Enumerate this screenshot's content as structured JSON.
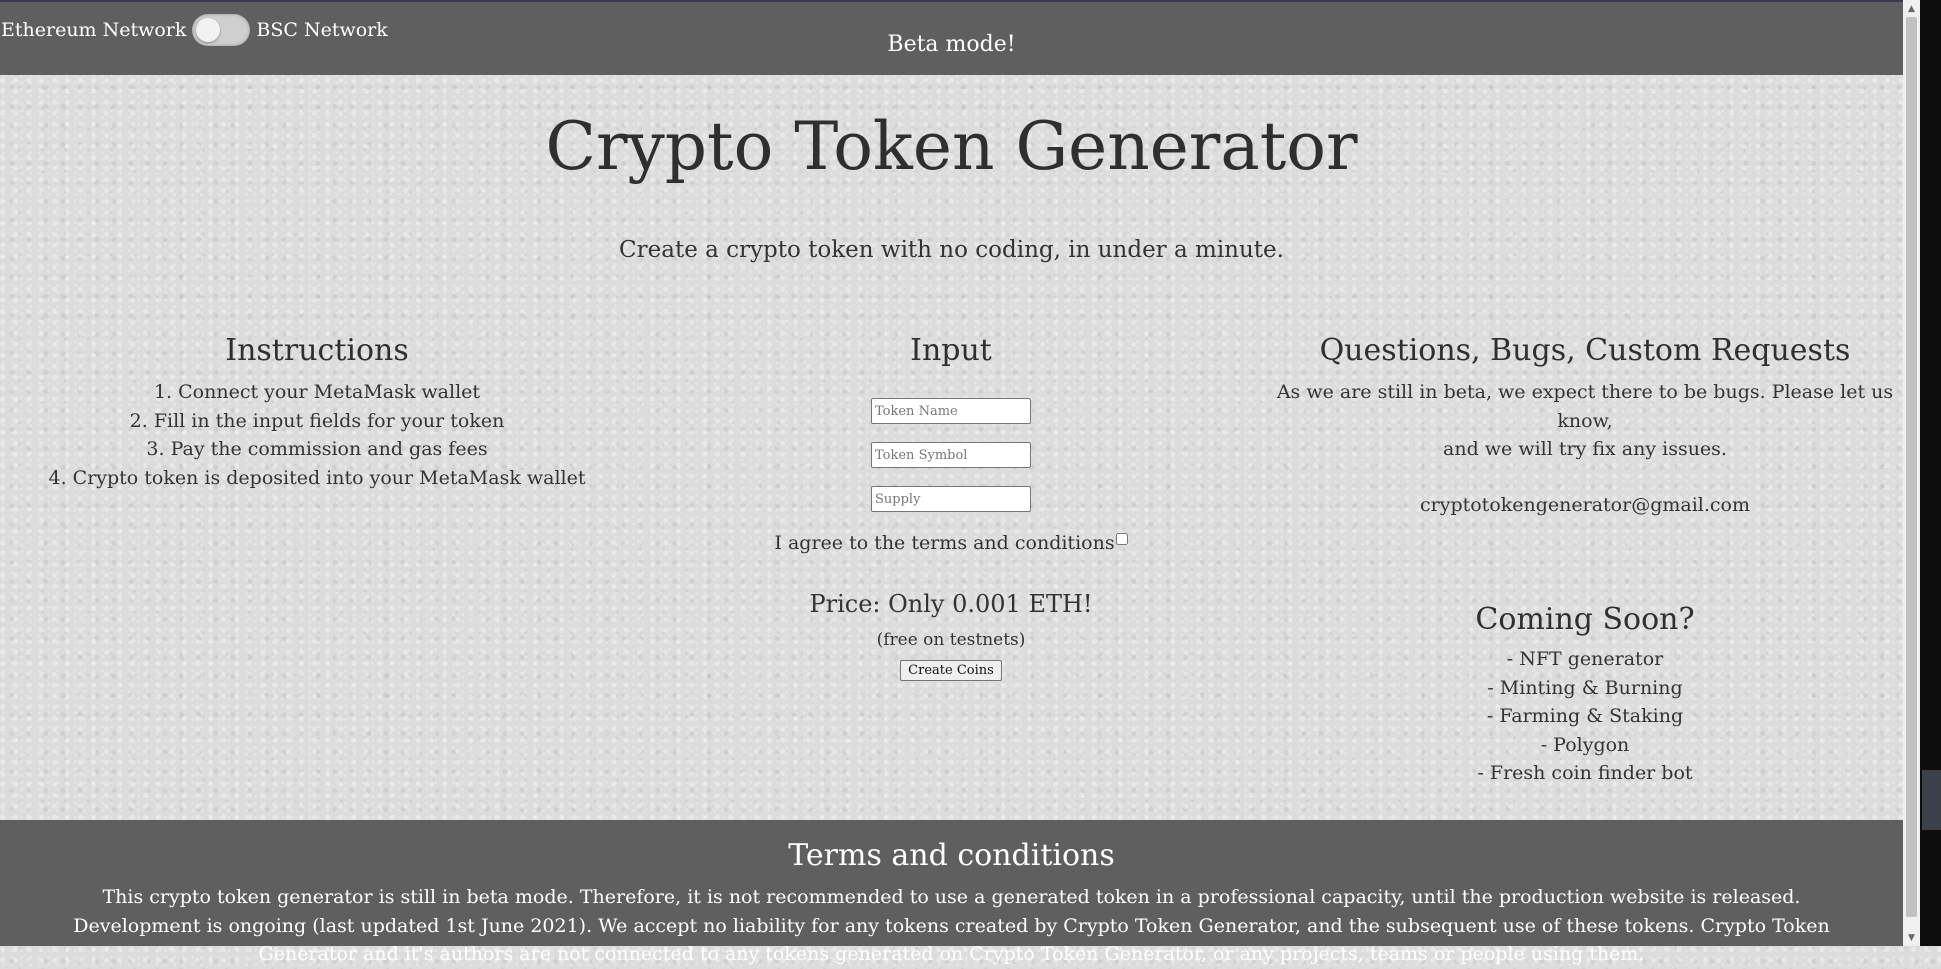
{
  "header": {
    "network_left": "Ethereum Network",
    "network_right": "BSC Network",
    "beta_label": "Beta mode!"
  },
  "hero": {
    "title": "Crypto Token Generator",
    "subtitle": "Create a crypto token with no coding, in under a minute."
  },
  "instructions": {
    "heading": "Instructions",
    "steps": [
      "1. Connect your MetaMask wallet",
      "2. Fill in the input fields for your token",
      "3. Pay the commission and gas fees",
      "4. Crypto token is deposited into your MetaMask wallet"
    ]
  },
  "input": {
    "heading": "Input",
    "token_name_placeholder": "Token Name",
    "token_symbol_placeholder": "Token Symbol",
    "supply_placeholder": "Supply",
    "agree_label": "I agree to the terms and conditions",
    "price": "Price: Only 0.001 ETH!",
    "price_note": "(free on testnets)",
    "create_button": "Create Coins"
  },
  "contact": {
    "heading": "Questions, Bugs, Custom Requests",
    "text_line1": "As we are still in beta, we expect there to be bugs. Please let us know,",
    "text_line2": "and we will try fix any issues.",
    "email": "cryptotokengenerator@gmail.com"
  },
  "coming_soon": {
    "heading": "Coming Soon?",
    "items": [
      "- NFT generator",
      "- Minting & Burning",
      "- Farming & Staking",
      "- Polygon",
      "- Fresh coin finder bot"
    ]
  },
  "terms": {
    "heading": "Terms and conditions",
    "text": "This crypto token generator is still in beta mode. Therefore, it is not recommended to use a generated token in a professional capacity, until the production website is released. Development is ongoing (last updated 1st June 2021). We accept no liability for any tokens created by Crypto Token Generator, and the subsequent use of these tokens. Crypto Token Generator and it's authors are not connected to any tokens generated on Crypto Token Generator, or any projects, teams or people using them."
  },
  "colors": {
    "bar_background": "#5f5f5f",
    "page_background": "#dcdcdc",
    "text": "#333333"
  }
}
